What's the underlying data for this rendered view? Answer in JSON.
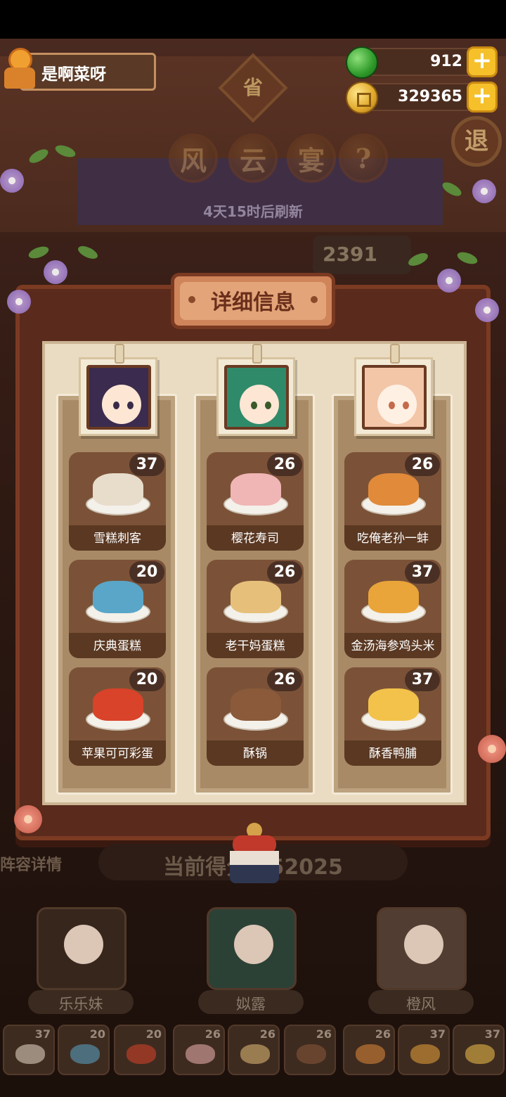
{
  "player": {
    "name": "是啊菜呀"
  },
  "currency": {
    "gems": "912",
    "coins": "329365"
  },
  "header": {
    "region_badge": "省",
    "title_chars": [
      "风",
      "云",
      "宴"
    ],
    "help": "?",
    "exit": "退",
    "refresh_text": "4天15时后刷新",
    "score_tab": "2391"
  },
  "dialog": {
    "title": "详细信息",
    "columns": [
      {
        "dishes": [
          {
            "name": "雪糕刺客",
            "count": "37",
            "color": "#e8dccb"
          },
          {
            "name": "庆典蛋糕",
            "count": "20",
            "color": "#5aa6c8"
          },
          {
            "name": "苹果可可彩蛋",
            "count": "20",
            "color": "#d8432a"
          }
        ]
      },
      {
        "dishes": [
          {
            "name": "樱花寿司",
            "count": "26",
            "color": "#f0b5b5"
          },
          {
            "name": "老干妈蛋糕",
            "count": "26",
            "color": "#e6c07a"
          },
          {
            "name": "酥锅",
            "count": "26",
            "color": "#8a5a3a"
          }
        ]
      },
      {
        "dishes": [
          {
            "name": "吃俺老孙一蚌",
            "count": "26",
            "color": "#e08a3a"
          },
          {
            "name": "金汤海参鸡头米",
            "count": "37",
            "color": "#e9a43a"
          },
          {
            "name": "酥香鸭脯",
            "count": "37",
            "color": "#f2c24a"
          }
        ]
      }
    ]
  },
  "bottom": {
    "team_link": "阵容详情",
    "score_label": "当前得分",
    "score_value": "252025",
    "chefs": [
      "乐乐妹",
      "姒露",
      "橙风"
    ],
    "mini_counts": [
      "37",
      "20",
      "20",
      "26",
      "26",
      "26",
      "26",
      "37",
      "37"
    ]
  }
}
